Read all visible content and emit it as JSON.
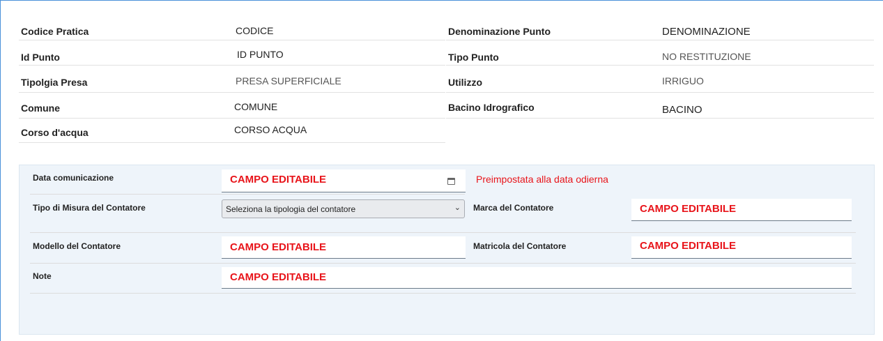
{
  "info": {
    "codice_pratica_label": "Codice Pratica",
    "codice_pratica_value": "CODICE",
    "denominazione_label": "Denominazione Punto",
    "denominazione_value": "DENOMINAZIONE",
    "id_punto_label": "Id Punto",
    "id_punto_value": "ID PUNTO",
    "tipo_punto_label": "Tipo Punto",
    "tipo_punto_value": "NO RESTITUZIONE",
    "tipolgia_presa_label": "Tipolgia Presa",
    "tipolgia_presa_value": "PRESA SUPERFICIALE",
    "utilizzo_label": "Utilizzo",
    "utilizzo_value": "IRRIGUO",
    "comune_label": "Comune",
    "comune_value": "COMUNE",
    "bacino_label": "Bacino Idrografico",
    "bacino_value": "BACINO",
    "corso_label": "Corso d'acqua",
    "corso_value": "CORSO ACQUA"
  },
  "form": {
    "data_comunicazione_label": "Data comunicazione",
    "data_comunicazione_value": "CAMPO EDITABILE",
    "data_note": "Preimpostata alla data odierna",
    "tipo_misura_label": "Tipo di Misura del Contatore",
    "tipo_misura_selected": "Seleziona la tipologia del contatore",
    "marca_label": "Marca del Contatore",
    "marca_value": "CAMPO EDITABILE",
    "modello_label": "Modello del Contatore",
    "modello_value": "CAMPO EDITABILE",
    "matricola_label": "Matricola del Contatore",
    "matricola_value": "CAMPO EDITABILE",
    "note_label": "Note",
    "note_value": "CAMPO EDITABILE"
  },
  "colors": {
    "frame": "#4a90d9",
    "panel_bg": "#eef4fa",
    "editable_text": "#e8141a"
  },
  "icons": {
    "calendar": "calendar-icon",
    "dropdown": "chevron-down-icon"
  }
}
